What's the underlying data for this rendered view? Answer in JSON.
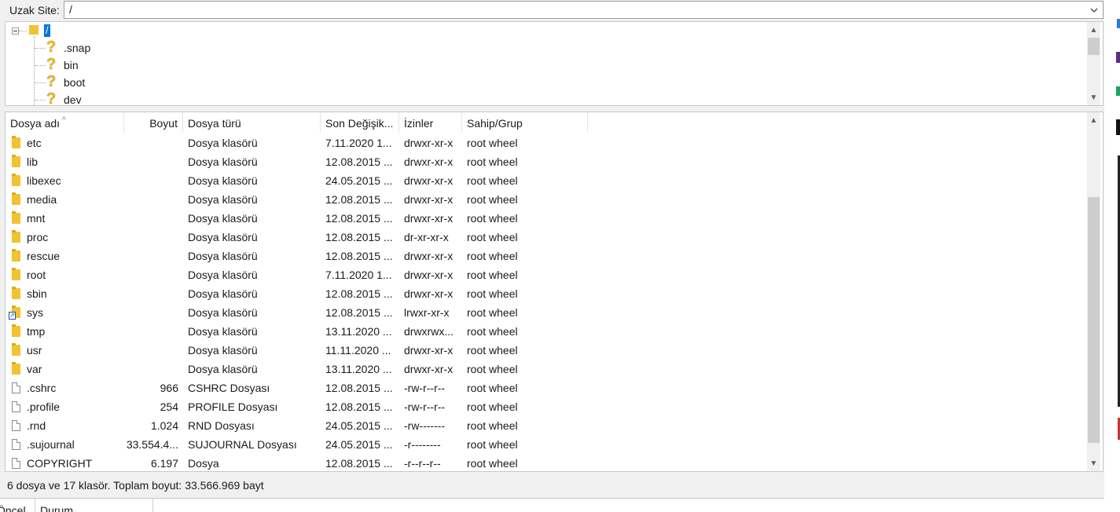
{
  "address": {
    "label": "Uzak Site:",
    "value": "/"
  },
  "tree": {
    "root_label": "/",
    "items": [
      {
        "name": ".snap"
      },
      {
        "name": "bin"
      },
      {
        "name": "boot"
      },
      {
        "name": "dev"
      }
    ]
  },
  "columns": {
    "name": "Dosya adı",
    "size": "Boyut",
    "type": "Dosya türü",
    "modified": "Son Değişik...",
    "perms": "İzinler",
    "owner": "Sahip/Grup"
  },
  "files": [
    {
      "name": "etc",
      "size": "",
      "type": "Dosya klasörü",
      "modified": "7.11.2020 1...",
      "perms": "drwxr-xr-x",
      "owner": "root wheel",
      "icon": "folder"
    },
    {
      "name": "lib",
      "size": "",
      "type": "Dosya klasörü",
      "modified": "12.08.2015 ...",
      "perms": "drwxr-xr-x",
      "owner": "root wheel",
      "icon": "folder"
    },
    {
      "name": "libexec",
      "size": "",
      "type": "Dosya klasörü",
      "modified": "24.05.2015 ...",
      "perms": "drwxr-xr-x",
      "owner": "root wheel",
      "icon": "folder"
    },
    {
      "name": "media",
      "size": "",
      "type": "Dosya klasörü",
      "modified": "12.08.2015 ...",
      "perms": "drwxr-xr-x",
      "owner": "root wheel",
      "icon": "folder"
    },
    {
      "name": "mnt",
      "size": "",
      "type": "Dosya klasörü",
      "modified": "12.08.2015 ...",
      "perms": "drwxr-xr-x",
      "owner": "root wheel",
      "icon": "folder"
    },
    {
      "name": "proc",
      "size": "",
      "type": "Dosya klasörü",
      "modified": "12.08.2015 ...",
      "perms": "dr-xr-xr-x",
      "owner": "root wheel",
      "icon": "folder"
    },
    {
      "name": "rescue",
      "size": "",
      "type": "Dosya klasörü",
      "modified": "12.08.2015 ...",
      "perms": "drwxr-xr-x",
      "owner": "root wheel",
      "icon": "folder"
    },
    {
      "name": "root",
      "size": "",
      "type": "Dosya klasörü",
      "modified": "7.11.2020 1...",
      "perms": "drwxr-xr-x",
      "owner": "root wheel",
      "icon": "folder"
    },
    {
      "name": "sbin",
      "size": "",
      "type": "Dosya klasörü",
      "modified": "12.08.2015 ...",
      "perms": "drwxr-xr-x",
      "owner": "root wheel",
      "icon": "folder"
    },
    {
      "name": "sys",
      "size": "",
      "type": "Dosya klasörü",
      "modified": "12.08.2015 ...",
      "perms": "lrwxr-xr-x",
      "owner": "root wheel",
      "icon": "folder-link"
    },
    {
      "name": "tmp",
      "size": "",
      "type": "Dosya klasörü",
      "modified": "13.11.2020 ...",
      "perms": "drwxrwx...",
      "owner": "root wheel",
      "icon": "folder"
    },
    {
      "name": "usr",
      "size": "",
      "type": "Dosya klasörü",
      "modified": "11.11.2020 ...",
      "perms": "drwxr-xr-x",
      "owner": "root wheel",
      "icon": "folder"
    },
    {
      "name": "var",
      "size": "",
      "type": "Dosya klasörü",
      "modified": "13.11.2020 ...",
      "perms": "drwxr-xr-x",
      "owner": "root wheel",
      "icon": "folder"
    },
    {
      "name": ".cshrc",
      "size": "966",
      "type": "CSHRC Dosyası",
      "modified": "12.08.2015 ...",
      "perms": "-rw-r--r--",
      "owner": "root wheel",
      "icon": "file"
    },
    {
      "name": ".profile",
      "size": "254",
      "type": "PROFILE Dosyası",
      "modified": "12.08.2015 ...",
      "perms": "-rw-r--r--",
      "owner": "root wheel",
      "icon": "file"
    },
    {
      "name": ".rnd",
      "size": "1.024",
      "type": "RND Dosyası",
      "modified": "24.05.2015 ...",
      "perms": "-rw-------",
      "owner": "root wheel",
      "icon": "file"
    },
    {
      "name": ".sujournal",
      "size": "33.554.4...",
      "type": "SUJOURNAL Dosyası",
      "modified": "24.05.2015 ...",
      "perms": "-r--------",
      "owner": "root wheel",
      "icon": "file"
    },
    {
      "name": "COPYRIGHT",
      "size": "6.197",
      "type": "Dosya",
      "modified": "12.08.2015 ...",
      "perms": "-r--r--r--",
      "owner": "root wheel",
      "icon": "file"
    }
  ],
  "status_text": "6 dosya ve 17 klasör. Toplam boyut: 33.566.969 bayt",
  "queue_tabs": [
    "Öncel",
    "Durum"
  ]
}
